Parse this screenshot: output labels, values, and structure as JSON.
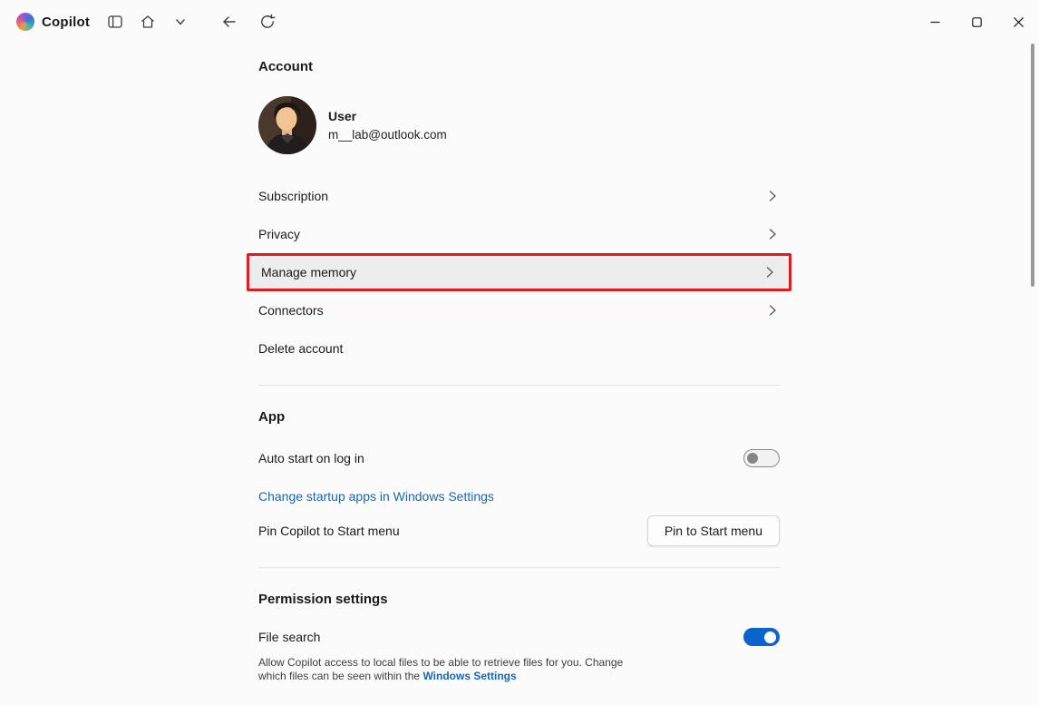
{
  "titlebar": {
    "app_name": "Copilot",
    "icons": [
      "copilot-logo",
      "new-window",
      "home",
      "chevron-down",
      "back",
      "refresh",
      "minimize",
      "maximize",
      "close"
    ]
  },
  "account": {
    "heading": "Account",
    "user_name": "User",
    "user_email": "m__lab@outlook.com",
    "items": [
      {
        "label": "Subscription"
      },
      {
        "label": "Privacy"
      },
      {
        "label": "Manage memory"
      },
      {
        "label": "Connectors"
      },
      {
        "label": "Delete account"
      }
    ]
  },
  "app_section": {
    "heading": "App",
    "auto_start_label": "Auto start on log in",
    "auto_start_on": false,
    "startup_link": "Change startup apps in Windows Settings",
    "pin_label": "Pin Copilot to Start menu",
    "pin_button_label": "Pin to Start menu"
  },
  "permissions": {
    "heading": "Permission settings",
    "file_search_label": "File search",
    "file_search_on": true,
    "file_search_description": "Allow Copilot access to local files to be able to retrieve files for you. Change which files can be seen within the ",
    "file_search_link": "Windows Settings"
  },
  "colors": {
    "link_blue": "#1766b4",
    "toggle_on_blue": "#0b63ce",
    "highlight_red": "#dc1c21"
  }
}
